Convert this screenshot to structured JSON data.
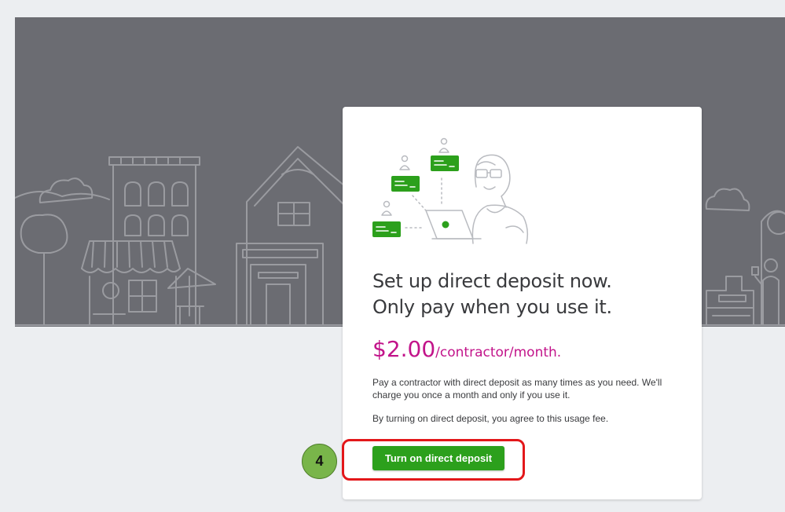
{
  "banner": {
    "image": "city-skyline-line-illustration"
  },
  "card": {
    "illustration": "contractors-payment-illustration",
    "headline_line1": "Set up direct deposit now.",
    "headline_line2": "Only pay when you use it.",
    "price_amount": "$2.00",
    "price_unit": "/contractor/month.",
    "description": "Pay a contractor with direct deposit as many times as you need. We'll charge you once a month and only if you use it.",
    "agreement": "By turning on direct deposit, you agree to this usage fee.",
    "cta_label": "Turn on direct deposit"
  },
  "annotation": {
    "step_number": "4",
    "highlight_color": "#e3171a"
  },
  "colors": {
    "accent_green": "#2ca01c",
    "price_magenta": "#c2148a",
    "banner_gray": "#6b6c72"
  }
}
